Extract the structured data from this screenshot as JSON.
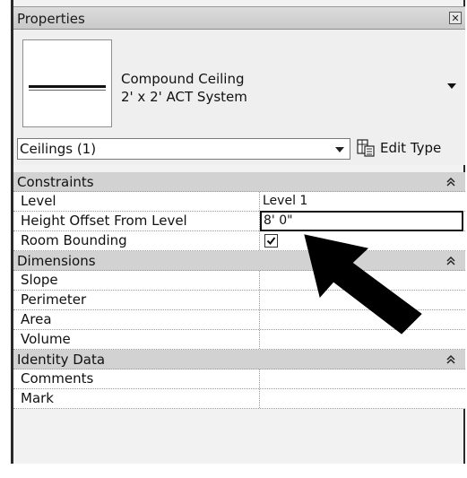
{
  "panel": {
    "title": "Properties",
    "close_icon": "close-icon"
  },
  "type_selector": {
    "family": "Compound Ceiling",
    "type": "2' x 2' ACT System"
  },
  "filter": {
    "value": "Ceilings (1)",
    "edit_type_label": "Edit Type"
  },
  "groups": {
    "constraints": {
      "title": "Constraints",
      "rows": [
        {
          "name": "Level",
          "value": "Level 1"
        },
        {
          "name": "Height Offset From Level",
          "value": "8'  0\""
        },
        {
          "name": "Room Bounding",
          "checked": true
        }
      ]
    },
    "dimensions": {
      "title": "Dimensions",
      "rows": [
        {
          "name": "Slope",
          "value": ""
        },
        {
          "name": "Perimeter",
          "value": ""
        },
        {
          "name": "Area",
          "value": ""
        },
        {
          "name": "Volume",
          "value": ""
        }
      ]
    },
    "identity": {
      "title": "Identity Data",
      "rows": [
        {
          "name": "Comments",
          "value": ""
        },
        {
          "name": "Mark",
          "value": ""
        }
      ]
    }
  },
  "colors": {
    "group_header": "#d2d2d2",
    "panel_bg": "#efefef",
    "arrow": "#000000"
  }
}
